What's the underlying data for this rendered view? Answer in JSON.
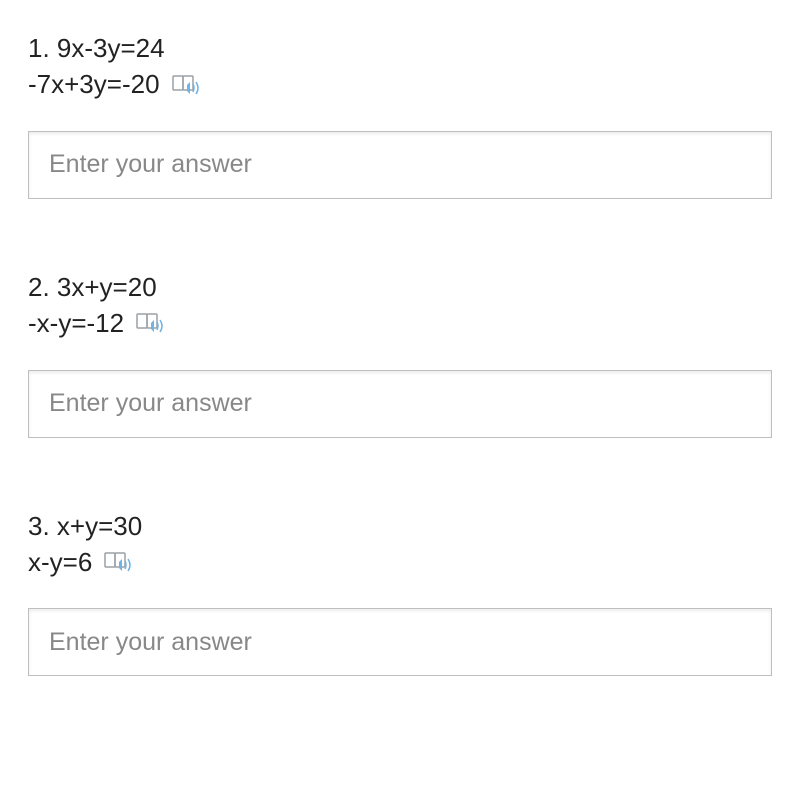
{
  "questions": [
    {
      "line1": "1. 9x-3y=24",
      "line2": "-7x+3y=-20",
      "placeholder": "Enter your answer",
      "value": ""
    },
    {
      "line1": "2. 3x+y=20",
      "line2": "-x-y=-12",
      "placeholder": "Enter your answer",
      "value": ""
    },
    {
      "line1": "3. x+y=30",
      "line2": "x-y=6",
      "placeholder": "Enter your answer",
      "value": ""
    }
  ]
}
